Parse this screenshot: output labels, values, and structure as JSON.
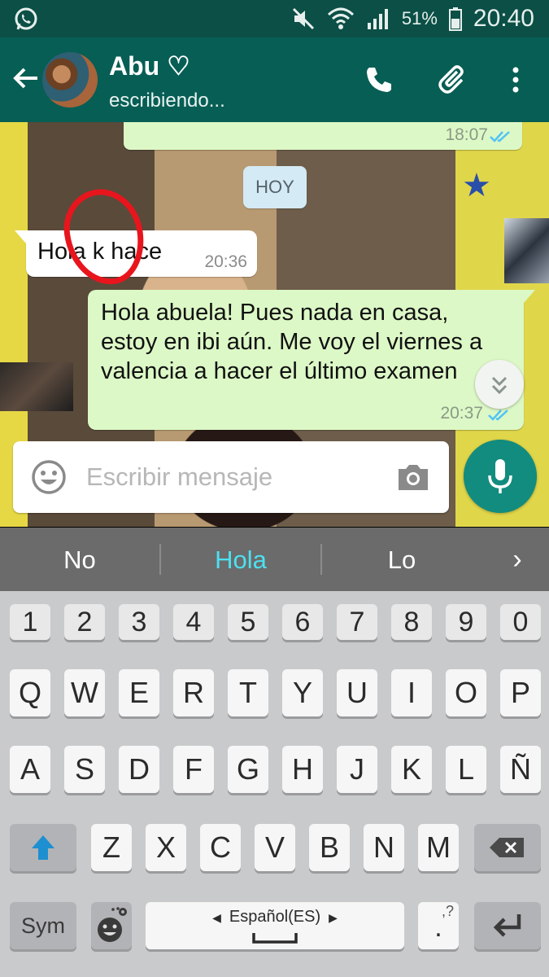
{
  "status_bar": {
    "battery": "51%",
    "time": "20:40"
  },
  "contact": {
    "name": "Abu ♡",
    "status": "escribiendo..."
  },
  "icons": {
    "back": "back-arrow-icon",
    "call": "phone-icon",
    "attach": "paperclip-icon",
    "menu": "more-vert-icon",
    "emoji": "emoji-icon",
    "camera": "camera-icon",
    "mic": "mic-icon",
    "scroll": "chevron-double-down-icon"
  },
  "messages": {
    "top_time": "18:07",
    "date_divider": "HOY",
    "incoming": {
      "text": "Hola k hace",
      "time": "20:36"
    },
    "outgoing": {
      "text": "Hola abuela! Pues nada en casa, estoy en ibi aún. Me voy el viernes a valencia a hacer el último examen",
      "time": "20:37"
    }
  },
  "composer": {
    "placeholder": "Escribir mensaje"
  },
  "suggestions": [
    "No",
    "Hola",
    "Lo"
  ],
  "keyboard": {
    "numbers": [
      "1",
      "2",
      "3",
      "4",
      "5",
      "6",
      "7",
      "8",
      "9",
      "0"
    ],
    "row1": [
      "Q",
      "W",
      "E",
      "R",
      "T",
      "Y",
      "U",
      "I",
      "O",
      "P"
    ],
    "row2": [
      "A",
      "S",
      "D",
      "F",
      "G",
      "H",
      "J",
      "K",
      "L",
      "Ñ"
    ],
    "row3": [
      "Z",
      "X",
      "C",
      "V",
      "B",
      "N",
      "M"
    ],
    "sym": "Sym",
    "space": "Español(ES)",
    "punct": ".",
    "punct_alt": ",?"
  },
  "colors": {
    "header": "#075e54",
    "status": "#0b4f46",
    "bubble_out": "#dcf8c6",
    "bubble_in": "#ffffff",
    "accent": "#128c7e",
    "suggest_highlight": "#4de0f0",
    "read_ticks": "#4fc3f7"
  }
}
